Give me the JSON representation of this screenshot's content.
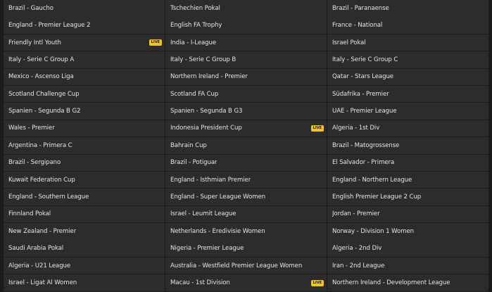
{
  "live_badge": "LIVE",
  "columns": [
    {
      "items": [
        {
          "label": "Brazil - Gaucho",
          "live": false
        },
        {
          "label": "England - Premier League 2",
          "live": false
        },
        {
          "label": "Friendly Intl Youth",
          "live": true
        },
        {
          "label": "Italy - Serie C Group A",
          "live": false
        },
        {
          "label": "Mexico - Ascenso Liga",
          "live": false
        },
        {
          "label": "Scotland Challenge Cup",
          "live": false
        },
        {
          "label": "Spanien - Segunda B G2",
          "live": false
        },
        {
          "label": "Wales - Premier",
          "live": false
        },
        {
          "label": "Argentina - Primera C",
          "live": false
        },
        {
          "label": "Brazil - Sergipano",
          "live": false
        },
        {
          "label": "Kuwait Federation Cup",
          "live": false
        },
        {
          "label": "England - Southern League",
          "live": false
        },
        {
          "label": "Finnland Pokal",
          "live": false
        },
        {
          "label": "New Zealand - Premier",
          "live": false
        },
        {
          "label": "Saudi Arabia Pokal",
          "live": false
        },
        {
          "label": "Algeria - U21 League",
          "live": false
        },
        {
          "label": "Israel - Ligat Al Women",
          "live": false
        }
      ]
    },
    {
      "items": [
        {
          "label": "Tschechien Pokal",
          "live": false
        },
        {
          "label": "English FA Trophy",
          "live": false
        },
        {
          "label": "India - I-League",
          "live": false
        },
        {
          "label": "Italy - Serie C Group B",
          "live": false
        },
        {
          "label": "Northern Ireland - Premier",
          "live": false
        },
        {
          "label": "Scotland FA Cup",
          "live": false
        },
        {
          "label": "Spanien - Segunda B G3",
          "live": false
        },
        {
          "label": "Indonesia President Cup",
          "live": true
        },
        {
          "label": "Bahrain Cup",
          "live": false
        },
        {
          "label": "Brazil - Potiguar",
          "live": false
        },
        {
          "label": "England - Isthmian Premier",
          "live": false
        },
        {
          "label": "England - Super League Women",
          "live": false
        },
        {
          "label": "Israel - Leumit League",
          "live": false
        },
        {
          "label": "Netherlands - Eredivisie Women",
          "live": false
        },
        {
          "label": "Nigeria - Premier League",
          "live": false
        },
        {
          "label": "Australia - Westfield Premier League Women",
          "live": false
        },
        {
          "label": "Macau - 1st Division",
          "live": true
        }
      ]
    },
    {
      "items": [
        {
          "label": "Brazil - Paranaense",
          "live": false
        },
        {
          "label": "France - National",
          "live": false
        },
        {
          "label": "Israel Pokal",
          "live": false
        },
        {
          "label": "Italy - Serie C Group C",
          "live": false
        },
        {
          "label": "Qatar - Stars League",
          "live": false
        },
        {
          "label": "Südafrika - Premier",
          "live": false
        },
        {
          "label": "UAE - Premier League",
          "live": false
        },
        {
          "label": "Algeria - 1st Div",
          "live": false
        },
        {
          "label": "Brazil - Matogrossense",
          "live": false
        },
        {
          "label": "El Salvador - Primera",
          "live": false
        },
        {
          "label": "England - Northern League",
          "live": false
        },
        {
          "label": "English Premier League 2 Cup",
          "live": false
        },
        {
          "label": "Jordan - Premier",
          "live": false
        },
        {
          "label": "Norway - Division 1 Women",
          "live": false
        },
        {
          "label": "Algeria - 2nd Div",
          "live": false
        },
        {
          "label": "Iran - 2nd League",
          "live": false
        },
        {
          "label": "Northern Ireland - Development League",
          "live": false
        }
      ]
    }
  ]
}
